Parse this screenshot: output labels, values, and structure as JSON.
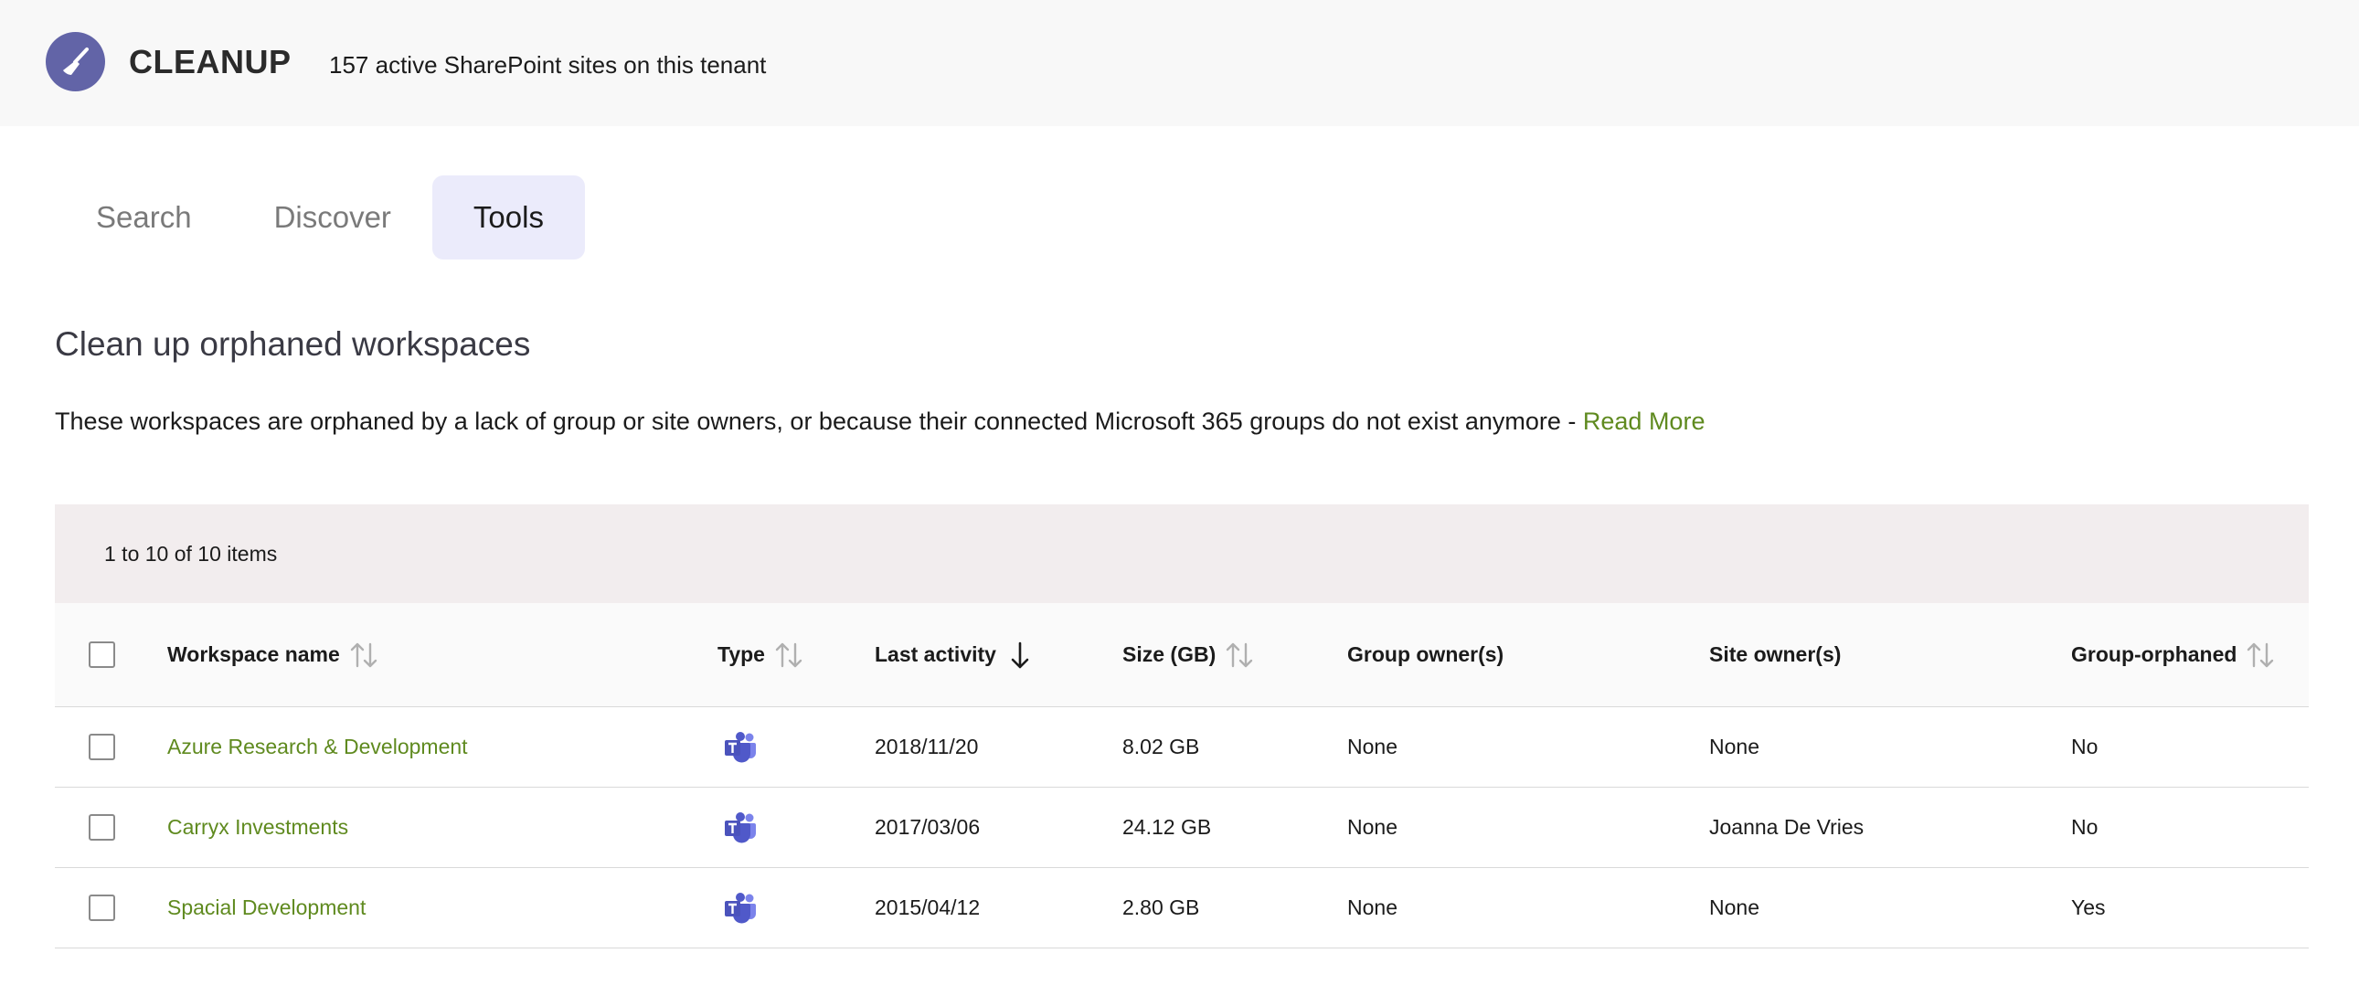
{
  "header": {
    "app_name": "CLEANUP",
    "tenant_info": "157 active SharePoint sites on this tenant",
    "logo_icon": "broom-icon",
    "logo_color": "#6264a7"
  },
  "tabs": [
    {
      "label": "Search",
      "active": false
    },
    {
      "label": "Discover",
      "active": false
    },
    {
      "label": "Tools",
      "active": true
    }
  ],
  "section": {
    "title": "Clean up orphaned workspaces",
    "description": "These workspaces are orphaned by a lack of group or site owners, or because their connected Microsoft 365 groups do not exist anymore - ",
    "read_more": "Read More"
  },
  "table": {
    "pager_text": "1 to 10 of 10 items",
    "columns": {
      "name": "Workspace name",
      "type": "Type",
      "last_activity": "Last activity",
      "size": "Size (GB)",
      "group_owners": "Group owner(s)",
      "site_owners": "Site owner(s)",
      "group_orphaned": "Group-orphaned"
    },
    "sort": {
      "column": "last_activity",
      "direction": "descending"
    },
    "rows": [
      {
        "name": "Azure Research & Development",
        "type_icon": "teams-icon",
        "last_activity": "2018/11/20",
        "size": "8.02 GB",
        "group_owners": "None",
        "site_owners": "None",
        "group_orphaned": "No"
      },
      {
        "name": "Carryx Investments",
        "type_icon": "teams-icon",
        "last_activity": "2017/03/06",
        "size": "24.12 GB",
        "group_owners": "None",
        "site_owners": "Joanna De Vries",
        "group_orphaned": "No"
      },
      {
        "name": "Spacial Development",
        "type_icon": "teams-icon",
        "last_activity": "2015/04/12",
        "size": "2.80 GB",
        "group_owners": "None",
        "site_owners": "None",
        "group_orphaned": "Yes"
      }
    ]
  },
  "colors": {
    "accent_link": "#5f8a1f",
    "active_tab_bg": "#ebebfb",
    "teams_purple": "#5059c9"
  }
}
